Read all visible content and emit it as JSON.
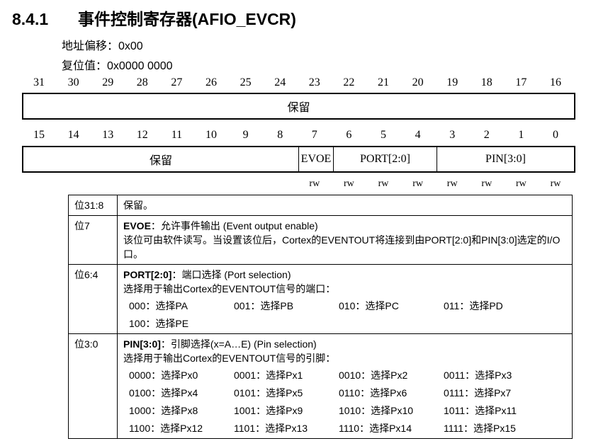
{
  "section": {
    "number": "8.4.1",
    "title": "事件控制寄存器(AFIO_EVCR)"
  },
  "meta": {
    "offset": "地址偏移：0x00",
    "reset": "复位值：0x0000 0000"
  },
  "upper_bits": [
    "31",
    "30",
    "29",
    "28",
    "27",
    "26",
    "25",
    "24",
    "23",
    "22",
    "21",
    "20",
    "19",
    "18",
    "17",
    "16"
  ],
  "lower_bits": [
    "15",
    "14",
    "13",
    "12",
    "11",
    "10",
    "9",
    "8",
    "7",
    "6",
    "5",
    "4",
    "3",
    "2",
    "1",
    "0"
  ],
  "upper_fields": [
    {
      "label": "保留"
    }
  ],
  "lower_fields": [
    {
      "label": "保留"
    },
    {
      "label": "EVOE"
    },
    {
      "label": "PORT[2:0]"
    },
    {
      "label": "PIN[3:0]"
    }
  ],
  "access": [
    "rw",
    "rw",
    "rw",
    "rw",
    "rw",
    "rw",
    "rw",
    "rw"
  ],
  "rows": [
    {
      "pos": "位31:8",
      "name": "",
      "text": "保留。"
    },
    {
      "pos": "位7",
      "name": "EVOE",
      "text": "：允许事件输出 (Event output enable)",
      "desc": "该位可由软件读写。当设置该位后，Cortex的EVENTOUT将连接到由PORT[2:0]和PIN[3:0]选定的I/O口。"
    },
    {
      "pos": "位6:4",
      "name": "PORT[2:0]",
      "text": "：端口选择 (Port selection)",
      "desc": "选择用于输出Cortex的EVENTOUT信号的端口：",
      "options": [
        "000：选择PA",
        "001：选择PB",
        "010：选择PC",
        "011：选择PD",
        "100：选择PE"
      ]
    },
    {
      "pos": "位3:0",
      "name": "PIN[3:0]",
      "text": "：引脚选择(x=A…E) (Pin selection)",
      "desc": "选择用于输出Cortex的EVENTOUT信号的引脚：",
      "options": [
        "0000：选择Px0",
        "0001：选择Px1",
        "0010：选择Px2",
        "0011：选择Px3",
        "0100：选择Px4",
        "0101：选择Px5",
        "0110：选择Px6",
        "0111：选择Px7",
        "1000：选择Px8",
        "1001：选择Px9",
        "1010：选择Px10",
        "1011：选择Px11",
        "1100：选择Px12",
        "1101：选择Px13",
        "1110：选择Px14",
        "1111：选择Px15"
      ]
    }
  ]
}
